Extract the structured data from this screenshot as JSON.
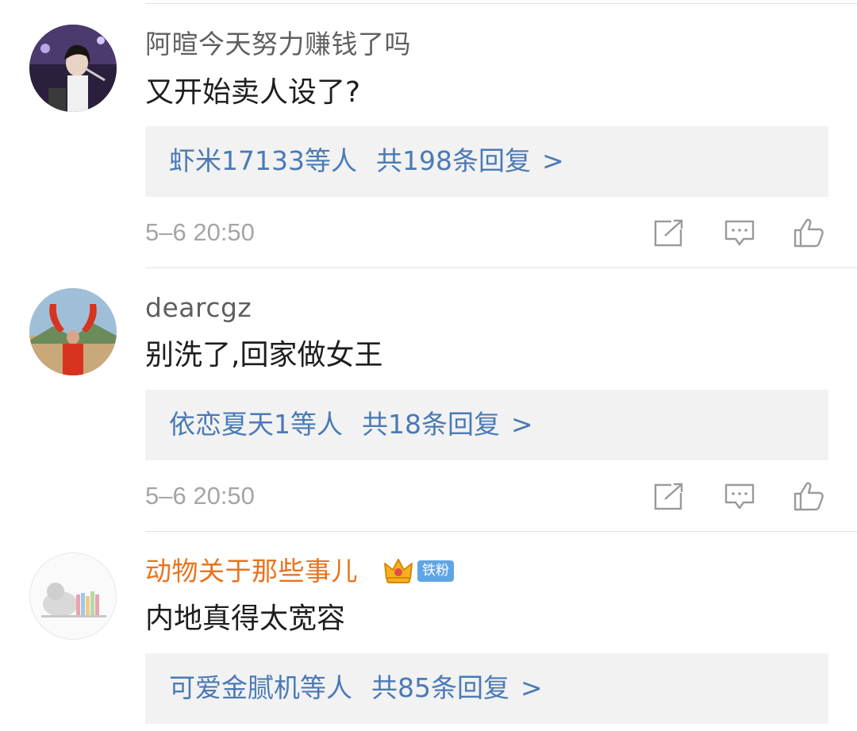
{
  "comments": [
    {
      "username": "阿暄今天努力赚钱了吗",
      "text": "又开始卖人设了?",
      "reply_preview": {
        "who": "虾米17133等人",
        "total": "共198条回复",
        "arrow": ">"
      },
      "time": "5–6 20:50"
    },
    {
      "username": "dearcgz",
      "text": "别洗了,回家做女王",
      "reply_preview": {
        "who": "依恋夏天1等人",
        "total": "共18条回复",
        "arrow": ">"
      },
      "time": "5–6 20:50"
    },
    {
      "username": "动物关于那些事儿",
      "badge": "铁粉",
      "text": "内地真得太宽容",
      "reply_preview": {
        "who": "可爱金腻机等人",
        "total": "共85条回复",
        "arrow": ">"
      }
    }
  ],
  "icons": {
    "share": "share-icon",
    "comment": "comment-icon",
    "like": "thumbs-up-icon",
    "crown": "crown-icon"
  },
  "colors": {
    "username": "#5f5f5f",
    "username_vip": "#e8741e",
    "reply_link": "#4a7ab6",
    "timestamp": "#a5a5a5",
    "reply_bg": "#f2f2f2",
    "badge_bg": "#5fa5e6"
  }
}
